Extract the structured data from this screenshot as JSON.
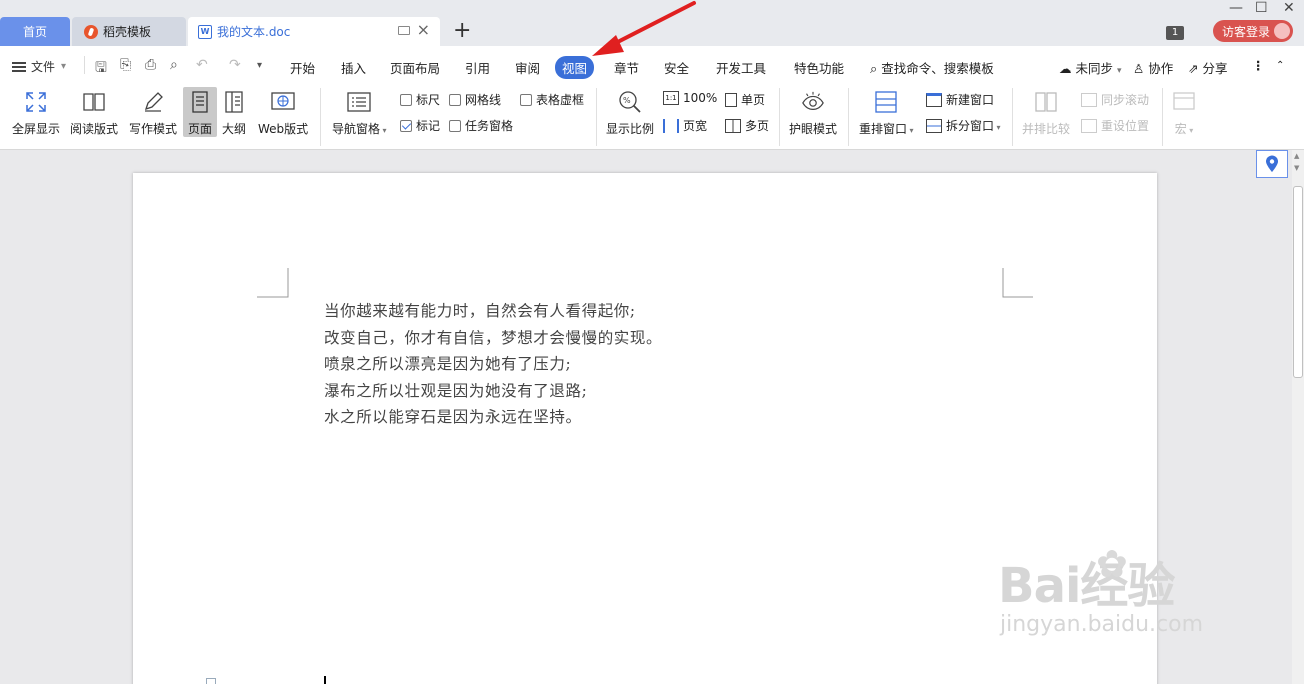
{
  "tabs": {
    "home": "首页",
    "template": "稻壳模板",
    "document": "我的文本.doc",
    "new_tab": "+"
  },
  "window": {
    "notification_count": "1",
    "login_label": "访客登录"
  },
  "menu": {
    "file": "文件",
    "items": [
      "开始",
      "插入",
      "页面布局",
      "引用",
      "审阅",
      "视图",
      "章节",
      "安全",
      "开发工具",
      "特色功能"
    ],
    "active": "视图",
    "search": "查找命令、搜索模板",
    "sync": "未同步",
    "collab": "协作",
    "share": "分享"
  },
  "ribbon": {
    "fullscreen": "全屏显示",
    "read_mode": "阅读版式",
    "write_mode": "写作模式",
    "page": "页面",
    "outline": "大纲",
    "web_layout": "Web版式",
    "nav_pane": "导航窗格",
    "ruler": "标尺",
    "gridlines": "网格线",
    "table_gridlines": "表格虚框",
    "marks": "标记",
    "task_pane": "任务窗格",
    "zoom": "显示比例",
    "zoom_100": "100%",
    "page_width": "页宽",
    "single_page": "单页",
    "multi_page": "多页",
    "eye_mode": "护眼模式",
    "rearrange": "重排窗口",
    "new_window": "新建窗口",
    "split_window": "拆分窗口",
    "side_by_side": "并排比较",
    "sync_scroll": "同步滚动",
    "reset_position": "重设位置",
    "macro": "宏"
  },
  "document": {
    "lines": [
      "当你越来越有能力时，自然会有人看得起你;",
      "改变自己，你才有自信，梦想才会慢慢的实现。",
      "喷泉之所以漂亮是因为她有了压力;",
      "瀑布之所以壮观是因为她没有了退路;",
      "水之所以能穿石是因为永远在坚持。"
    ]
  },
  "watermark": {
    "brand": "Bai经验",
    "url": "jingyan.baidu.com"
  },
  "colors": {
    "accent": "#3a6fd8",
    "home_tab": "#6a91ea",
    "login": "#d9534f",
    "arrow": "#e02020"
  }
}
